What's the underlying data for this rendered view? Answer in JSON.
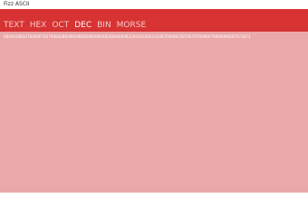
{
  "app": {
    "title": "Fizz ASCII"
  },
  "tabs": [
    {
      "label": "TEXT",
      "active": false
    },
    {
      "label": "HEX",
      "active": false
    },
    {
      "label": "OCT",
      "active": false
    },
    {
      "label": "DEC",
      "active": true
    },
    {
      "label": "BIN",
      "active": false
    },
    {
      "label": "MORSE",
      "active": false
    }
  ],
  "content": {
    "output_text": "084092085078089076079084086088098092084090083084089083100103100101087098087087067076096079089090067073073"
  },
  "colors": {
    "header": "#d73333",
    "content": "#eaa8a8",
    "active_tab": "#ffffff",
    "inactive_tab": "#f6c9c9"
  }
}
